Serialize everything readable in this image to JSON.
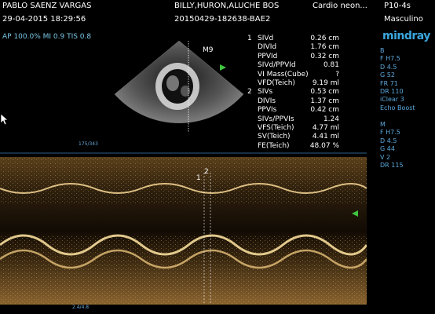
{
  "header": {
    "patient_name": "PABLO SAENZ VARGAS",
    "date_time": "29-04-2015 18:29:56",
    "referrer": "BILLY,HURON,ALUCHE BOS",
    "exam_id": "20150429-182638-BAE2",
    "exam_type": "Cardio neon...",
    "probe": "P10-4s",
    "sex": "Masculino",
    "power_info": "AP 100.0%  MI 0.9  TIS 0.8"
  },
  "brand": "mindray",
  "image_label": "M9",
  "params_b": [
    "B",
    "F H7.5",
    "D 4.5",
    "G 52",
    "FR 71",
    "DR 110",
    "iClear 3",
    "Echo Boost"
  ],
  "params_m": [
    "M",
    "F H7.5",
    "D 4.5",
    "G 44",
    "V 2",
    "DR 115"
  ],
  "measurements": [
    {
      "num": "1",
      "label": "SIVd",
      "value": "0.26 cm"
    },
    {
      "num": "",
      "label": "DIVId",
      "value": "1.76 cm"
    },
    {
      "num": "",
      "label": "PPVId",
      "value": "0.32 cm"
    },
    {
      "num": "",
      "label": "SIVd/PPVId",
      "value": "0.81"
    },
    {
      "num": "",
      "label": "VI Mass(Cube)",
      "value": "?"
    },
    {
      "num": "",
      "label": "VFD(Teich)",
      "value": "9.19 ml"
    },
    {
      "num": "2",
      "label": "SIVs",
      "value": "0.53 cm"
    },
    {
      "num": "",
      "label": "DIVIs",
      "value": "1.37 cm"
    },
    {
      "num": "",
      "label": "PPVIs",
      "value": "0.42 cm"
    },
    {
      "num": "",
      "label": "SIVs/PPVIs",
      "value": "1.24"
    },
    {
      "num": "",
      "label": "VFS(Teich)",
      "value": "4.77 ml"
    },
    {
      "num": "",
      "label": "SV(Teich)",
      "value": "4.41 ml"
    },
    {
      "num": "",
      "label": "FE(Teich)",
      "value": "48.07 %"
    }
  ],
  "scale_top": "175/343",
  "scale_bottom": "2.4/4.8",
  "caliper_labels": [
    "1",
    "2"
  ]
}
